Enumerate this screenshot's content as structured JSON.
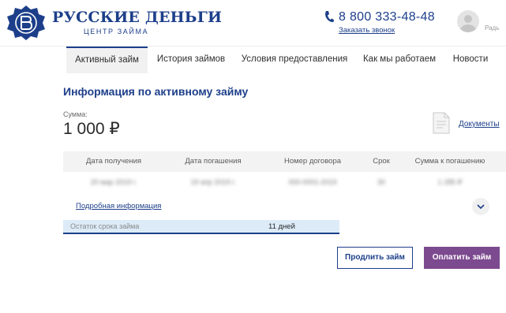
{
  "header": {
    "logo_title": "РУССКИЕ ДЕНЬГИ",
    "logo_subtitle": "ЦЕНТР ЗАЙМА",
    "phone": "8 800 333-48-48",
    "callback_link": "Заказать звонок",
    "user_name": "Радь"
  },
  "nav": {
    "tabs": [
      {
        "label": "Активный займ",
        "active": true
      },
      {
        "label": "История займов",
        "active": false
      },
      {
        "label": "Условия предоставления",
        "active": false
      },
      {
        "label": "Как мы работаем",
        "active": false
      },
      {
        "label": "Новости",
        "active": false
      }
    ]
  },
  "main": {
    "title": "Информация по активному займу",
    "sum_label": "Сумма:",
    "sum_value": "1 000 ₽",
    "documents_link": "Документы",
    "table": {
      "headers": [
        "Дата получения",
        "Дата погашения",
        "Номер договора",
        "Срок",
        "Сумма к погашению"
      ],
      "row": [
        "20 мар 2019 г.",
        "19 апр 2019 г.",
        "000-0001-2019",
        "30",
        "1 285 ₽"
      ]
    },
    "details_link": "Подробная информация",
    "remaining_label": "Остаток срока займа",
    "remaining_value": "11 дней",
    "extend_button": "Продлить займ",
    "pay_button": "Оплатить займ"
  },
  "colors": {
    "brand_blue": "#1d3f8a",
    "pay_purple": "#7c4a8f",
    "progress_fill": "#dcebf7"
  },
  "icons": [
    "logo-emblem",
    "phone-icon",
    "user-avatar-icon",
    "document-icon",
    "chevron-down-icon"
  ]
}
